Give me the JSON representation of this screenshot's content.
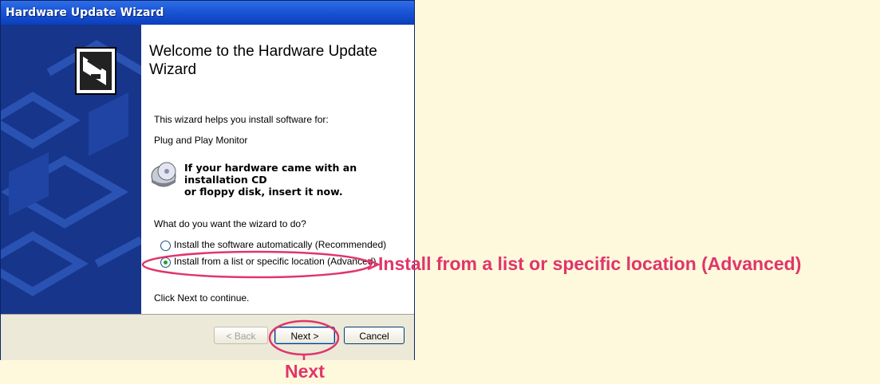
{
  "window": {
    "title": "Hardware Update Wizard"
  },
  "wizard": {
    "heading": "Welcome to the Hardware Update Wizard",
    "intro": "This wizard helps you install software for:",
    "device_name": "Plug and Play Monitor",
    "cd_prompt_line1": "If your hardware came with an installation CD",
    "cd_prompt_line2": "or floppy disk, insert it now.",
    "question": "What do you want the wizard to do?",
    "options": [
      {
        "label": "Install the software automatically (Recommended)",
        "selected": false
      },
      {
        "label": "Install from a list or specific location (Advanced)",
        "selected": true
      }
    ],
    "continue_hint": "Click Next to continue."
  },
  "buttons": {
    "back": "< Back",
    "next": "Next >",
    "cancel": "Cancel"
  },
  "annotations": {
    "option_callout": "Install from a list or specific location (Advanced)",
    "next_callout": "Next"
  },
  "colors": {
    "accent": "#e0356b",
    "title_bar": "#1a55d6",
    "side_panel": "#17358a",
    "background": "#fef9dc"
  },
  "icons": [
    "wizard-hardware-icon",
    "cd-disk-icon",
    "callout-arrow-icon"
  ]
}
